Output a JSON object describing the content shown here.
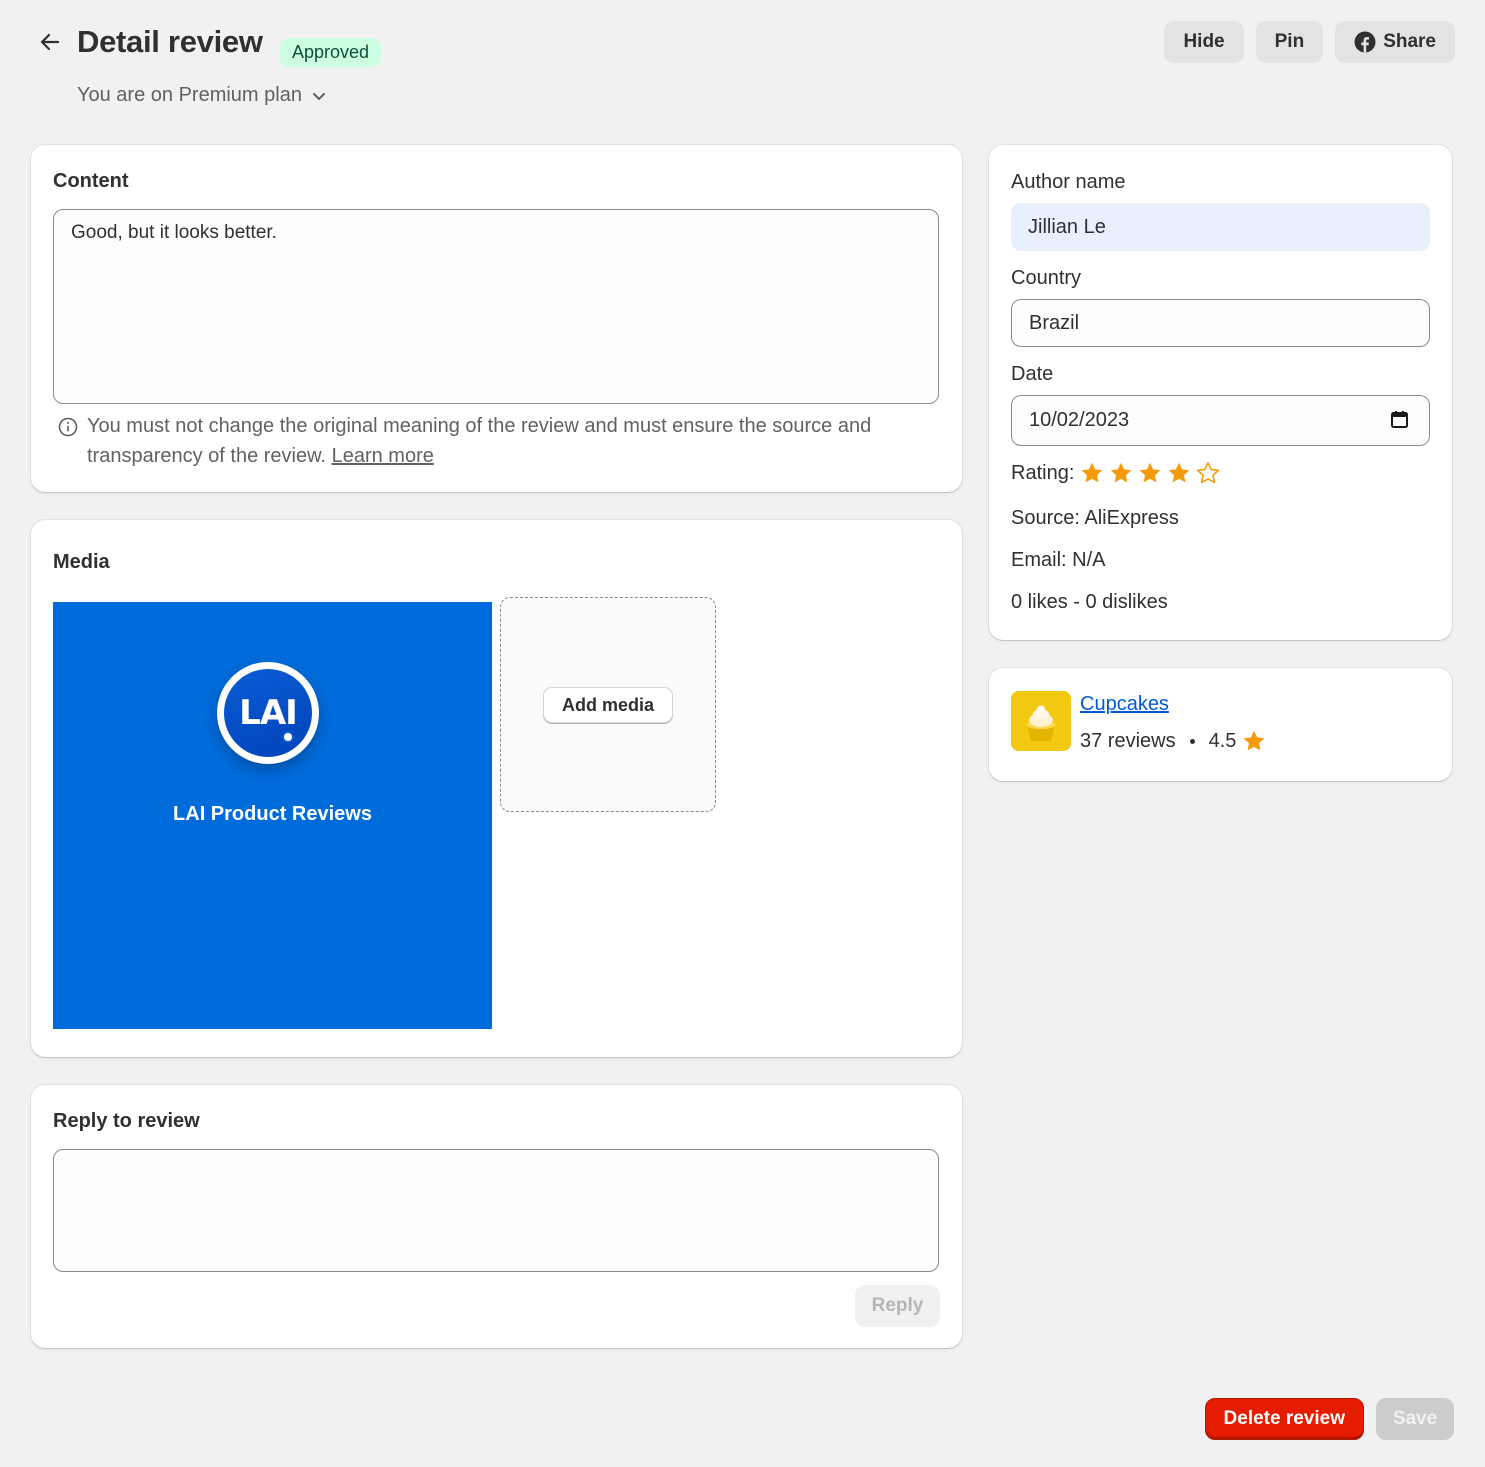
{
  "header": {
    "title": "Detail review",
    "status_badge": "Approved",
    "plan_label": "You are on Premium plan",
    "actions": {
      "hide": "Hide",
      "pin": "Pin",
      "share": "Share"
    }
  },
  "content_card": {
    "title": "Content",
    "review_text": "Good, but it looks better.",
    "note": "You must not change the original meaning of the review and must ensure the source and transparency of the review.",
    "learn_more": "Learn more"
  },
  "media_card": {
    "title": "Media",
    "image_logo_text": "LAI",
    "image_caption": "LAI Product Reviews",
    "add_media_label": "Add media"
  },
  "reply_card": {
    "title": "Reply to review",
    "reply_value": "",
    "reply_button": "Reply"
  },
  "details": {
    "author_label": "Author name",
    "author_value": "Jillian Le",
    "country_label": "Country",
    "country_value": "Brazil",
    "date_label": "Date",
    "date_value": "10/02/2023",
    "rating_label": "Rating:",
    "rating_value": 4,
    "rating_max": 5,
    "source_text": "Source: AliExpress",
    "email_text": "Email: N/A",
    "likes_text": "0 likes - 0 dislikes"
  },
  "product": {
    "name": "Cupcakes",
    "reviews_count": "37 reviews",
    "average_rating": "4.5"
  },
  "footer": {
    "delete_label": "Delete review",
    "save_label": "Save"
  },
  "colors": {
    "star": "#f49a0b",
    "badge_bg": "#cdfee1",
    "link": "#005bd3",
    "danger": "#e51c00",
    "media_bg": "#006bdb"
  }
}
